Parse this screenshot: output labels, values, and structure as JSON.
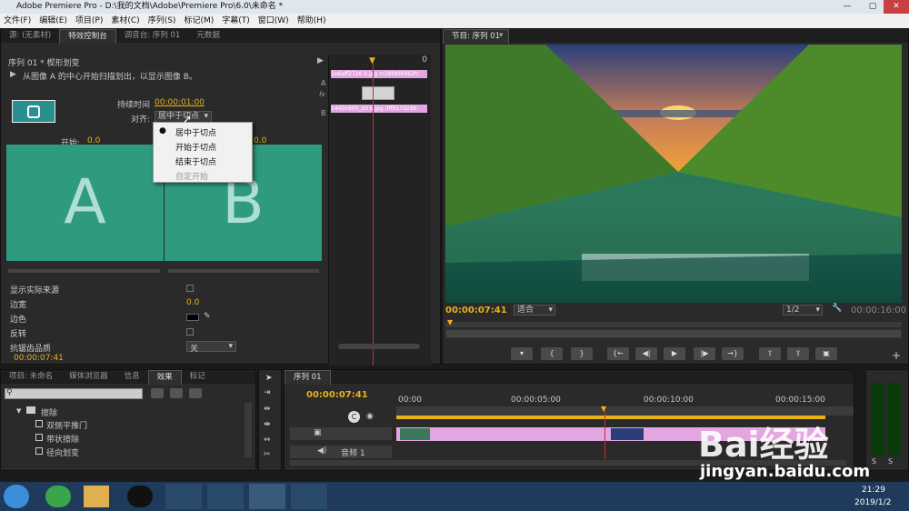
{
  "window": {
    "title": "Adobe Premiere Pro - D:\\我的文档\\Adobe\\Premiere Pro\\6.0\\未命名 *"
  },
  "menu": [
    "文件(F)",
    "编辑(E)",
    "项目(P)",
    "素材(C)",
    "序列(S)",
    "标记(M)",
    "字幕(T)",
    "窗口(W)",
    "帮助(H)"
  ],
  "effect_panel": {
    "tabs": [
      "源: (无素材)",
      "特效控制台",
      "调音台: 序列 01",
      "元数据"
    ],
    "header": "序列 01 * 楔形划变",
    "description": "从图像 A 的中心开始扫描划出，以显示图像 B。",
    "duration_label": "持续时间",
    "duration_value": "00:00:01:00",
    "align_label": "对齐:",
    "align_value": "居中于切点",
    "start_label": "开始:",
    "start_value": "0.0",
    "end_value": "0.0",
    "label_a": "A",
    "label_b": "B",
    "dropdown_options": [
      "居中于切点",
      "开始于切点",
      "结束于切点",
      "自定开始"
    ],
    "props": [
      "显示实际来源",
      "边宽",
      "边色",
      "反转",
      "抗锯齿品质"
    ],
    "border_width": "0.0",
    "aa_value": "关",
    "timecode": "00:00:07:41",
    "mini_clip_a": "1e6aff2726 b.jpg  m2896f6962fc",
    "mini_clip_b": "1440x900_20 b.jpg  0ff917d28b",
    "zero": "0"
  },
  "program": {
    "tab": "节目: 序列 01",
    "timecode": "00:00:07:41",
    "fit": "适合",
    "ratio": "1/2",
    "duration": "00:00:16:00",
    "buttons": [
      "marker",
      "in",
      "out",
      "go-in",
      "step-back",
      "play",
      "step-fwd",
      "go-out",
      "lift",
      "extract",
      "camera"
    ]
  },
  "project_panel": {
    "tabs": [
      "项目: 未命名",
      "媒体浏览器",
      "信息",
      "效果",
      "标记"
    ],
    "tree": [
      {
        "label": "擦除",
        "level": 0
      },
      {
        "label": "双侧平推门",
        "level": 1
      },
      {
        "label": "带状擦除",
        "level": 1
      },
      {
        "label": "径向划变",
        "level": 1
      }
    ]
  },
  "timeline": {
    "tab": "序列 01",
    "timecode": "00:00:07:41",
    "ruler": [
      "00:00",
      "00:00:05:00",
      "00:00:10:00",
      "00:00:15:00"
    ],
    "audio_track": "音频 1"
  },
  "meters": {
    "s1": "S",
    "s2": "S"
  },
  "watermark": {
    "text1": "Bai",
    "text2": "经验",
    "url": "jingyan.baidu.com"
  },
  "taskbar": {
    "time": "21:29",
    "date": "2019/1/2"
  }
}
